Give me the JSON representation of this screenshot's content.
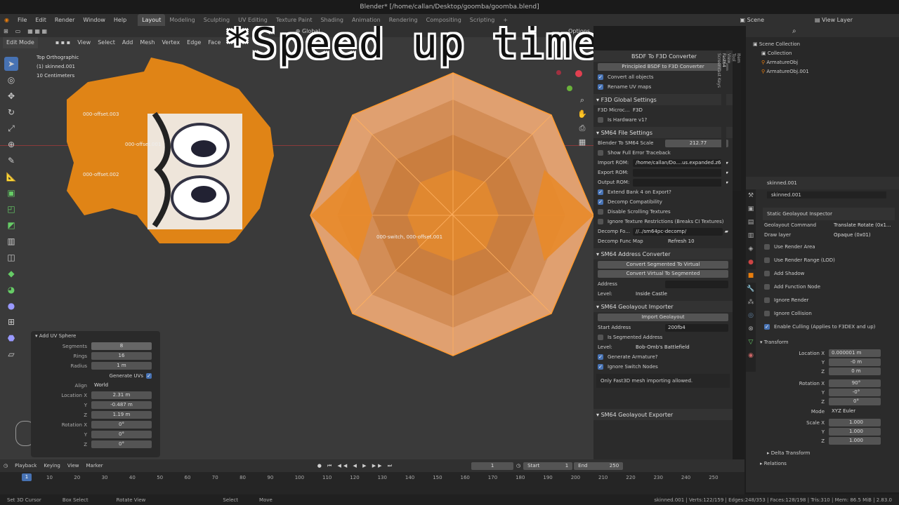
{
  "title": "Blender* [/home/callan/Desktop/goomba/goomba.blend]",
  "menus": [
    "File",
    "Edit",
    "Render",
    "Window",
    "Help"
  ],
  "workspaces": [
    "Layout",
    "Modeling",
    "Sculpting",
    "UV Editing",
    "Texture Paint",
    "Shading",
    "Animation",
    "Rendering",
    "Compositing",
    "Scripting"
  ],
  "scene": "Scene",
  "view_layer": "View Layer",
  "overlay_text": "*Speed up time*",
  "viewport": {
    "mode": "Edit Mode",
    "menus": [
      "View",
      "Select",
      "Add",
      "Mesh",
      "Vertex",
      "Edge",
      "Face"
    ],
    "transform": "Global",
    "options": "Options",
    "info_lines": [
      "Top Orthographic",
      "(1) skinned.001",
      "10 Centimeters"
    ],
    "labels": [
      "000-offset.003",
      "000-offset.001",
      "000-offset.002",
      "000-switch, 000-offset.001"
    ]
  },
  "op_panel": {
    "title": "Add UV Sphere",
    "segments_label": "Segments",
    "segments": "8",
    "rings_label": "Rings",
    "rings": "16",
    "radius_label": "Radius",
    "radius": "1 m",
    "gen_uvs": "Generate UVs",
    "align_label": "Align",
    "align": "World",
    "loc_label": "Location X",
    "loc_x": "2.31 m",
    "loc_y": "-0.487 m",
    "loc_z": "1.19 m",
    "rot_label": "Rotation X",
    "rot_x": "0°",
    "rot_y": "0°",
    "rot_z": "0°",
    "y": "Y",
    "z": "Z"
  },
  "npanel": {
    "head_partial": "BSDF To F3D Converter",
    "converter_btn": "Principled BSDF to F3D Converter",
    "convert_all": "Convert all objects",
    "rename_uv": "Rename UV maps",
    "f3d_global": "F3D Global Settings",
    "f3d_micro_label": "F3D Microc...",
    "f3d_micro": "F3D",
    "is_hw": "Is Hardware v1?",
    "sm64_file": "SM64 File Settings",
    "scale_label": "Blender To SM64 Scale",
    "scale": "212.77",
    "show_err": "Show Full Error Traceback",
    "import_rom_label": "Import ROM:",
    "import_rom": "/home/callan/Do....us.expanded.z64",
    "export_rom_label": "Export ROM:",
    "output_rom_label": "Output ROM:",
    "extend_bank": "Extend Bank 4 on Export?",
    "decomp_compat": "Decomp Compatibility",
    "disable_scroll": "Disable Scrolling Textures",
    "ignore_tex": "Ignore Texture Restrictions (Breaks CI Textures)",
    "decomp_fo_label": "Decomp Fo...",
    "decomp_fo": "//../sm64pc-decomp/",
    "func_map_label": "Decomp Func Map",
    "func_map": "Refresh 10",
    "addr_conv": "SM64 Address Converter",
    "seg_to_virt": "Convert Segmented To Virtual",
    "virt_to_seg": "Convert Virtual To Segmented",
    "address_label": "Address",
    "level_label": "Level:",
    "level1": "Inside Castle",
    "geo_importer": "SM64 Geolayout Importer",
    "import_geo": "Import Geolayout",
    "start_addr_label": "Start Address",
    "start_addr": "200fb4",
    "is_seg": "Is Segmented Address",
    "level2": "Bob-Omb's Battlefield",
    "gen_armature": "Generate Armature?",
    "ignore_switch": "Ignore Switch Nodes",
    "only_f3d": "Only Fast3D mesh importing allowed.",
    "geo_exporter": "SM64 Geolayout Exporter",
    "tabs": [
      "Item",
      "Tool",
      "View",
      "Fast64",
      "Screencast Keys"
    ]
  },
  "outliner": {
    "items": [
      "Scene Collection",
      "Collection",
      "ArmatureObj",
      "ArmatureObj.001"
    ]
  },
  "props": {
    "object": "skinned.001",
    "bone": "skinned.001",
    "inspector": "Static Geolayout Inspector",
    "geo_cmd_label": "Geolayout Command",
    "geo_cmd": "Translate Rotate (0x1...",
    "draw_layer_label": "Draw layer",
    "draw_layer": "Opaque (0x01)",
    "checks": [
      "Use Render Area",
      "Use Render Range (LOD)",
      "Add Shadow",
      "Add Function Node",
      "Ignore Render",
      "Ignore Collision",
      "Enable Culling (Applies to F3DEX and up)"
    ],
    "transform": "Transform",
    "loc_label": "Location X",
    "loc_x": "0.000001 m",
    "loc_y": "-0 m",
    "loc_z": "0 m",
    "rot_label": "Rotation X",
    "rot_x": "90°",
    "rot_y": "-0°",
    "rot_z": "0°",
    "mode_label": "Mode",
    "mode": "XYZ Euler",
    "scale_label": "Scale X",
    "scale_x": "1.000",
    "scale_y": "1.000",
    "scale_z": "1.000",
    "delta": "Delta Transform",
    "relations": "Relations",
    "y": "Y",
    "z": "Z"
  },
  "timeline": {
    "menus": [
      "Playback",
      "Keying",
      "View",
      "Marker"
    ],
    "frame": "1",
    "start_label": "Start",
    "start": "1",
    "end_label": "End",
    "end": "250",
    "ticks": [
      "10",
      "20",
      "30",
      "40",
      "50",
      "60",
      "70",
      "80",
      "90",
      "100",
      "110",
      "120",
      "130",
      "140",
      "150",
      "160",
      "170",
      "180",
      "190",
      "200",
      "210",
      "220",
      "230",
      "240",
      "250"
    ],
    "current": "1"
  },
  "status": {
    "left": [
      "Set 3D Cursor",
      "Box Select",
      "Rotate View",
      "Select",
      "Move"
    ],
    "right": "skinned.001 | Verts:122/159 | Edges:248/353 | Faces:128/198 | Tris:310 | Mem: 86.5 MiB | 2.83.0"
  }
}
